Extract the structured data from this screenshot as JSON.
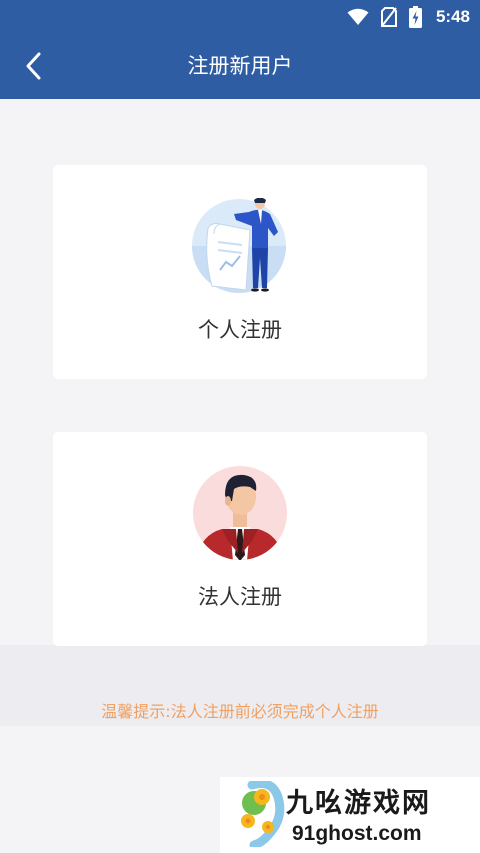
{
  "status_bar": {
    "time": "5:48",
    "icons": [
      "wifi-icon",
      "no-sim-icon",
      "battery-charging-icon"
    ]
  },
  "header": {
    "title": "注册新用户",
    "back_icon": "chevron-left-icon"
  },
  "cards": {
    "personal": {
      "label": "个人注册",
      "icon": "businessman-document-illustration"
    },
    "legal": {
      "label": "法人注册",
      "icon": "man-in-suit-avatar"
    }
  },
  "hint": {
    "text": "温馨提示:法人注册前必须完成个人注册"
  },
  "watermark": {
    "name": "九吆游戏网",
    "url": "91ghost.com"
  },
  "colors": {
    "header_bg": "#2f5da3",
    "page_bg": "#f4f4f6",
    "card_bg": "#ffffff",
    "hint_text": "#f0a063",
    "hint_band": "#ececf1"
  }
}
